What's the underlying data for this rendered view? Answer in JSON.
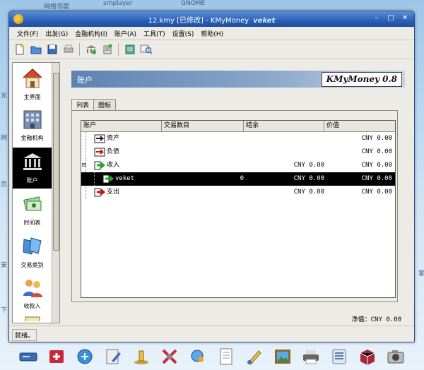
{
  "desktop": {
    "top_labels": [
      "网络邻居",
      "smplayer",
      "GNOME"
    ],
    "left_glyphs": [
      "光",
      "网",
      "页",
      "安",
      "下",
      "家"
    ]
  },
  "window": {
    "title": "12.kmy [已修改] - KMyMoney",
    "brand": "veket",
    "controls": {
      "minimize": "–",
      "maximize": "□",
      "close": "✕"
    }
  },
  "menu": [
    "文件(F)",
    "出发(G)",
    "金融机构(I)",
    "账户(A)",
    "工具(T)",
    "设置(S)",
    "帮助(H)"
  ],
  "toolbar_icons": [
    "new-file-icon",
    "open-folder-icon",
    "save-icon",
    "print-icon",
    "institution-icon",
    "account-icon",
    "transaction-icon",
    "find-icon"
  ],
  "sidebar": {
    "items": [
      {
        "label": "主界面",
        "icon": "home-icon"
      },
      {
        "label": "金融机构",
        "icon": "institution-icon"
      },
      {
        "label": "账户",
        "icon": "bank-icon",
        "selected": true
      },
      {
        "label": "时间表",
        "icon": "schedule-icon"
      },
      {
        "label": "交易类别",
        "icon": "categories-icon"
      },
      {
        "label": "收款人",
        "icon": "payees-icon"
      }
    ]
  },
  "page": {
    "title": "账户",
    "logo": "KMyMoney 0.8",
    "tabs": [
      {
        "label": "列表",
        "active": true
      },
      {
        "label": "图标",
        "active": false
      }
    ],
    "columns": [
      "账户",
      "交易数目",
      "结余",
      "价值"
    ],
    "rows": [
      {
        "name": "资产",
        "count": "",
        "balance": "",
        "value": "CNY 0.00",
        "level": 0,
        "icon": "asset-icon",
        "color": "#222222"
      },
      {
        "name": "负债",
        "count": "",
        "balance": "",
        "value": "CNY 0.00",
        "level": 0,
        "icon": "liability-icon",
        "color": "#cc1111"
      },
      {
        "name": "收入",
        "count": "",
        "balance": "CNY 0.00",
        "value": "CNY 0.00",
        "level": 0,
        "icon": "income-icon",
        "color": "#22aa22",
        "expander": "⊟"
      },
      {
        "name": "veket",
        "count": "0",
        "balance": "CNY 0.00",
        "value": "CNY 0.00",
        "level": 1,
        "icon": "income-icon",
        "color": "#22aa22",
        "selected": true
      },
      {
        "name": "支出",
        "count": "",
        "balance": "CNY 0.00",
        "value": "CNY 0.00",
        "level": 0,
        "icon": "expense-icon",
        "color": "#cc1111"
      }
    ],
    "networth": "净值：CNY 0.00"
  },
  "status": "就绪。",
  "taskbar_icons": [
    "drive-icon",
    "first-aid-icon",
    "network-icon",
    "editor-icon",
    "stamp-icon",
    "tools-icon",
    "search-globe-icon",
    "document-icon",
    "paint-icon",
    "picture-icon",
    "printer-icon",
    "list-icon",
    "package-icon",
    "camera-icon"
  ]
}
